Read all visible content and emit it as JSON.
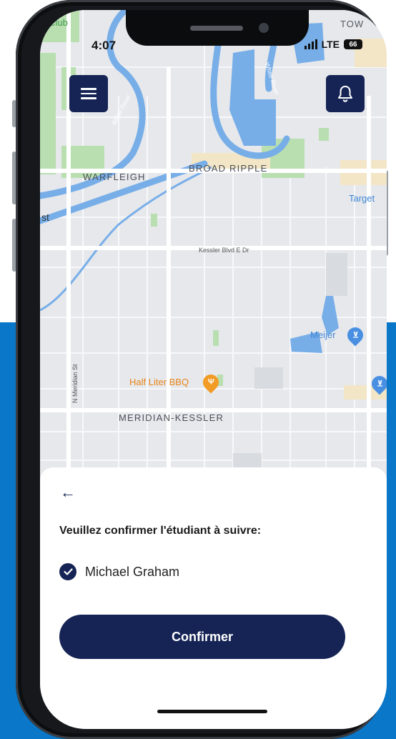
{
  "status_bar": {
    "time": "4:07",
    "network": "LTE",
    "battery": "66"
  },
  "map": {
    "area_labels": {
      "warfleigh": "WARFLEIGH",
      "broad_ripple": "BROAD RIPPLE",
      "meridian_kessler": "MERIDIAN-KESSLER"
    },
    "street_labels": {
      "kessler": "Kessler Blvd E Dr",
      "meridian": "N Meridian St"
    },
    "water_labels": {
      "white_river_west": "White River",
      "white_river_east": "White River"
    },
    "poi_labels": {
      "half_liter": "Half Liter BBQ",
      "meijer": "Meijer",
      "target": "Target"
    },
    "edge_labels": {
      "club": "y Club",
      "town": "TOW",
      "st": "st"
    }
  },
  "sheet": {
    "back_icon": "arrow-left-icon",
    "prompt": "Veuillez confirmer l'étudiant à suivre:",
    "student_name": "Michael Graham",
    "student_checked": true,
    "confirm_label": "Confirmer"
  },
  "colors": {
    "navy": "#152455",
    "background_blue": "#0a77c8",
    "map_base": "#e6e8ec",
    "water": "#78aee8",
    "park": "#b9dfb1"
  }
}
